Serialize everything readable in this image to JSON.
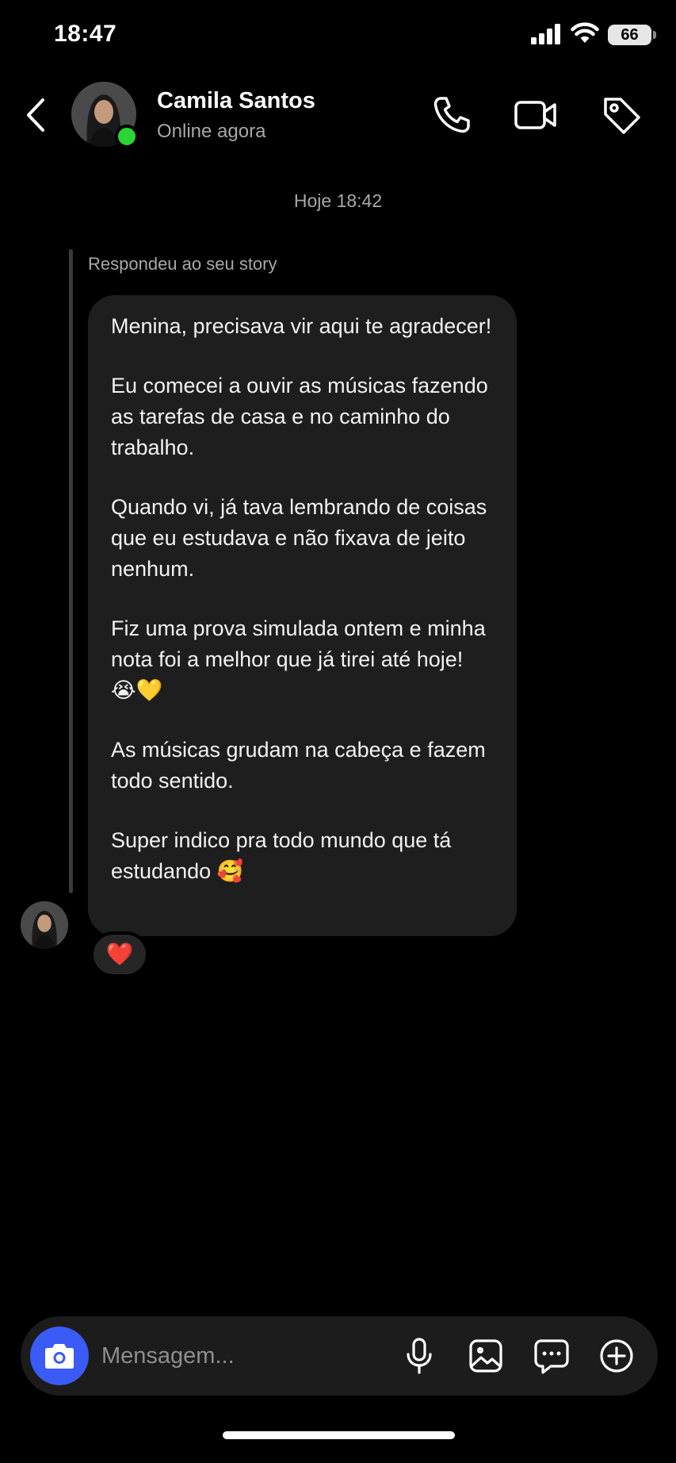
{
  "status_bar": {
    "time": "18:47",
    "battery": "66"
  },
  "header": {
    "contact_name": "Camila Santos",
    "contact_status": "Online agora"
  },
  "conversation": {
    "timestamp": "Hoje 18:42",
    "reply_label": "Respondeu ao seu story",
    "message": {
      "paragraphs": [
        "Menina, precisava vir aqui te agradecer!",
        "Eu comecei a ouvir as músicas fazendo as tarefas de casa e no caminho do trabalho.",
        "Quando vi, já tava lembrando de coisas que eu estudava e não fixava de jeito nenhum.",
        "Fiz uma prova simulada ontem e minha nota foi a melhor que já tirei até hoje! 😭💛",
        "As músicas grudam na cabeça e fazem todo sentido.",
        "Super indico pra todo mundo que tá estudando 🥰"
      ]
    },
    "reaction": "❤️"
  },
  "composer": {
    "placeholder": "Mensagem..."
  },
  "colors": {
    "background": "#000000",
    "bubble": "#1e1e1e",
    "online": "#2bd534",
    "camera_button": "#3b5bf6",
    "secondary_text": "#a8a8a8"
  }
}
